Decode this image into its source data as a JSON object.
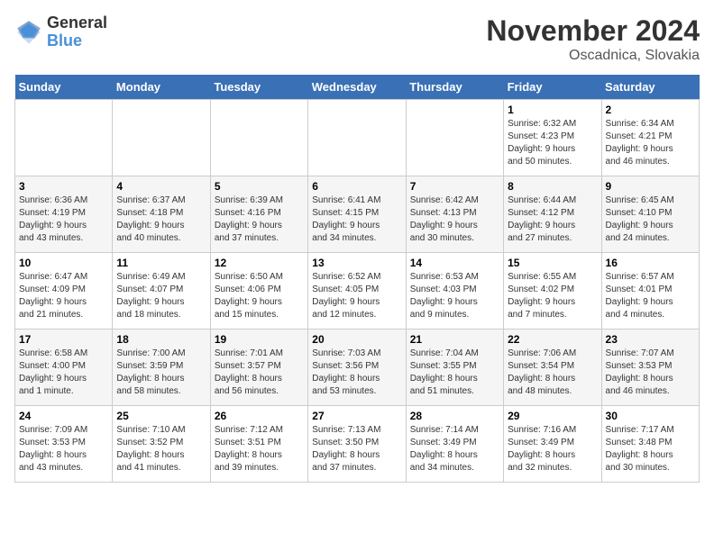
{
  "header": {
    "logo_general": "General",
    "logo_blue": "Blue",
    "month_title": "November 2024",
    "location": "Oscadnica, Slovakia"
  },
  "weekdays": [
    "Sunday",
    "Monday",
    "Tuesday",
    "Wednesday",
    "Thursday",
    "Friday",
    "Saturday"
  ],
  "weeks": [
    [
      {
        "day": "",
        "info": ""
      },
      {
        "day": "",
        "info": ""
      },
      {
        "day": "",
        "info": ""
      },
      {
        "day": "",
        "info": ""
      },
      {
        "day": "",
        "info": ""
      },
      {
        "day": "1",
        "info": "Sunrise: 6:32 AM\nSunset: 4:23 PM\nDaylight: 9 hours\nand 50 minutes."
      },
      {
        "day": "2",
        "info": "Sunrise: 6:34 AM\nSunset: 4:21 PM\nDaylight: 9 hours\nand 46 minutes."
      }
    ],
    [
      {
        "day": "3",
        "info": "Sunrise: 6:36 AM\nSunset: 4:19 PM\nDaylight: 9 hours\nand 43 minutes."
      },
      {
        "day": "4",
        "info": "Sunrise: 6:37 AM\nSunset: 4:18 PM\nDaylight: 9 hours\nand 40 minutes."
      },
      {
        "day": "5",
        "info": "Sunrise: 6:39 AM\nSunset: 4:16 PM\nDaylight: 9 hours\nand 37 minutes."
      },
      {
        "day": "6",
        "info": "Sunrise: 6:41 AM\nSunset: 4:15 PM\nDaylight: 9 hours\nand 34 minutes."
      },
      {
        "day": "7",
        "info": "Sunrise: 6:42 AM\nSunset: 4:13 PM\nDaylight: 9 hours\nand 30 minutes."
      },
      {
        "day": "8",
        "info": "Sunrise: 6:44 AM\nSunset: 4:12 PM\nDaylight: 9 hours\nand 27 minutes."
      },
      {
        "day": "9",
        "info": "Sunrise: 6:45 AM\nSunset: 4:10 PM\nDaylight: 9 hours\nand 24 minutes."
      }
    ],
    [
      {
        "day": "10",
        "info": "Sunrise: 6:47 AM\nSunset: 4:09 PM\nDaylight: 9 hours\nand 21 minutes."
      },
      {
        "day": "11",
        "info": "Sunrise: 6:49 AM\nSunset: 4:07 PM\nDaylight: 9 hours\nand 18 minutes."
      },
      {
        "day": "12",
        "info": "Sunrise: 6:50 AM\nSunset: 4:06 PM\nDaylight: 9 hours\nand 15 minutes."
      },
      {
        "day": "13",
        "info": "Sunrise: 6:52 AM\nSunset: 4:05 PM\nDaylight: 9 hours\nand 12 minutes."
      },
      {
        "day": "14",
        "info": "Sunrise: 6:53 AM\nSunset: 4:03 PM\nDaylight: 9 hours\nand 9 minutes."
      },
      {
        "day": "15",
        "info": "Sunrise: 6:55 AM\nSunset: 4:02 PM\nDaylight: 9 hours\nand 7 minutes."
      },
      {
        "day": "16",
        "info": "Sunrise: 6:57 AM\nSunset: 4:01 PM\nDaylight: 9 hours\nand 4 minutes."
      }
    ],
    [
      {
        "day": "17",
        "info": "Sunrise: 6:58 AM\nSunset: 4:00 PM\nDaylight: 9 hours\nand 1 minute."
      },
      {
        "day": "18",
        "info": "Sunrise: 7:00 AM\nSunset: 3:59 PM\nDaylight: 8 hours\nand 58 minutes."
      },
      {
        "day": "19",
        "info": "Sunrise: 7:01 AM\nSunset: 3:57 PM\nDaylight: 8 hours\nand 56 minutes."
      },
      {
        "day": "20",
        "info": "Sunrise: 7:03 AM\nSunset: 3:56 PM\nDaylight: 8 hours\nand 53 minutes."
      },
      {
        "day": "21",
        "info": "Sunrise: 7:04 AM\nSunset: 3:55 PM\nDaylight: 8 hours\nand 51 minutes."
      },
      {
        "day": "22",
        "info": "Sunrise: 7:06 AM\nSunset: 3:54 PM\nDaylight: 8 hours\nand 48 minutes."
      },
      {
        "day": "23",
        "info": "Sunrise: 7:07 AM\nSunset: 3:53 PM\nDaylight: 8 hours\nand 46 minutes."
      }
    ],
    [
      {
        "day": "24",
        "info": "Sunrise: 7:09 AM\nSunset: 3:53 PM\nDaylight: 8 hours\nand 43 minutes."
      },
      {
        "day": "25",
        "info": "Sunrise: 7:10 AM\nSunset: 3:52 PM\nDaylight: 8 hours\nand 41 minutes."
      },
      {
        "day": "26",
        "info": "Sunrise: 7:12 AM\nSunset: 3:51 PM\nDaylight: 8 hours\nand 39 minutes."
      },
      {
        "day": "27",
        "info": "Sunrise: 7:13 AM\nSunset: 3:50 PM\nDaylight: 8 hours\nand 37 minutes."
      },
      {
        "day": "28",
        "info": "Sunrise: 7:14 AM\nSunset: 3:49 PM\nDaylight: 8 hours\nand 34 minutes."
      },
      {
        "day": "29",
        "info": "Sunrise: 7:16 AM\nSunset: 3:49 PM\nDaylight: 8 hours\nand 32 minutes."
      },
      {
        "day": "30",
        "info": "Sunrise: 7:17 AM\nSunset: 3:48 PM\nDaylight: 8 hours\nand 30 minutes."
      }
    ]
  ]
}
